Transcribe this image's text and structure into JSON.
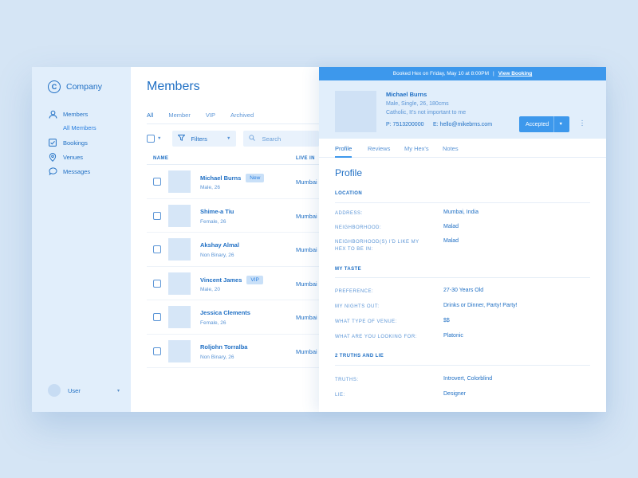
{
  "brand": {
    "logo_letter": "C",
    "name": "Company"
  },
  "sidebar": {
    "items": [
      {
        "label": "Members",
        "icon": "user-icon"
      },
      {
        "label": "Bookings",
        "icon": "checkbox-icon"
      },
      {
        "label": "Venues",
        "icon": "map-pin-icon"
      },
      {
        "label": "Messages",
        "icon": "chat-bubble-icon"
      }
    ],
    "sub_item": "All Members",
    "user": {
      "name": "User",
      "chevron": "▾"
    }
  },
  "members": {
    "title": "Members",
    "tabs": [
      "All",
      "Member",
      "VIP",
      "Archived"
    ],
    "filters_label": "Filters",
    "search_placeholder": "Search",
    "columns": {
      "name": "NAME",
      "live_in": "LIVE IN"
    },
    "rows": [
      {
        "name": "Michael Burns",
        "badge": "New",
        "sub": "Male, 26",
        "city": "Mumbai"
      },
      {
        "name": "Shime-a Tiu",
        "badge": "",
        "sub": "Female, 26",
        "city": "Mumbai"
      },
      {
        "name": "Akshay Almal",
        "badge": "",
        "sub": "Non Binary, 26",
        "city": "Mumbai"
      },
      {
        "name": "Vincent James",
        "badge": "VIP",
        "sub": "Male, 20",
        "city": "Mumbai"
      },
      {
        "name": "Jessica Clements",
        "badge": "",
        "sub": "Female, 26",
        "city": "Mumbai"
      },
      {
        "name": "Roljohn Torralba",
        "badge": "",
        "sub": "Non Binary, 26",
        "city": "Mumbai"
      }
    ]
  },
  "panel": {
    "banner": {
      "text": "Booked Hex on Friday, May 10 at 8:00PM",
      "separator": "|",
      "link": "View Booking"
    },
    "profile": {
      "name": "Michael Burns",
      "line1": "Male, Single, 26, 180cms",
      "line2": "Catholic, It's not important to me",
      "phone": "P: 7513200000",
      "email": "E: hello@mikebrns.com",
      "status": "Accepted"
    },
    "tabs": [
      "Profile",
      "Reviews",
      "My Hex's",
      "Notes"
    ],
    "title": "Profile",
    "sections": {
      "location": "LOCATION",
      "taste": "MY TASTE",
      "truths": "2 TRUTHS AND LIE"
    },
    "fields": {
      "address": {
        "label": "ADDRESS:",
        "value": "Mumbai, India"
      },
      "neighborhood": {
        "label": "NEIGHBORHOOD:",
        "value": "Malad"
      },
      "hex_neighborhood": {
        "label": "NEIGHBORHOOD(S) I'D LIKE MY HEX TO BE IN:",
        "value": "Malad"
      },
      "preference": {
        "label": "PREFERENCE:",
        "value": "27-30 Years Old"
      },
      "nights_out": {
        "label": "MY NIGHTS OUT:",
        "value": "Drinks or Dinner, Party! Party!"
      },
      "venue_type": {
        "label": "WHAT TYPE OF VENUE:",
        "value": "$$"
      },
      "looking_for": {
        "label": "WHAT ARE YOU LOOKING FOR:",
        "value": "Platonic"
      },
      "truths": {
        "label": "TRUTHS:",
        "value": "Introvert, Colorblind"
      },
      "lie": {
        "label": "LIE:",
        "value": "Designer"
      }
    }
  },
  "colors": {
    "accent": "#3d98ec",
    "text": "#1f6fc4",
    "sidebar_bg": "#e1eefb",
    "page_bg": "#d5e5f5"
  }
}
